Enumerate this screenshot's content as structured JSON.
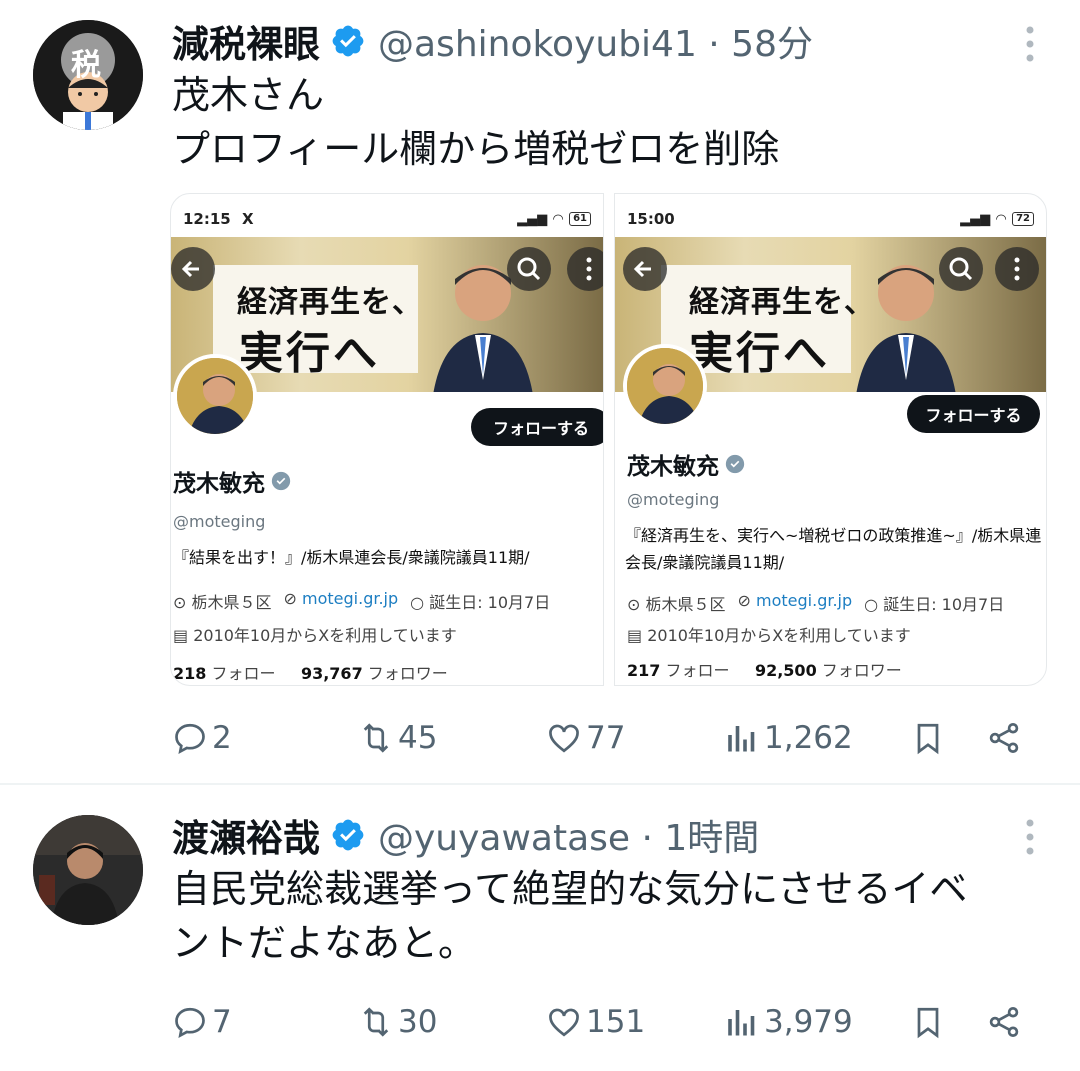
{
  "colors": {
    "verified": "#1d9bf0",
    "text": "#0f1419",
    "secondary": "#536471",
    "link": "#1d7ec2"
  },
  "tweets": [
    {
      "name": "減税裸眼",
      "handle": "@ashinokoyubi41 · 58分",
      "text_line1": "茂木さん",
      "text_line2": "プロフィール欄から増税ゼロを削除",
      "avatar_badge": "税",
      "media": [
        {
          "status_time": "12:15",
          "status_x": "X",
          "battery": "61",
          "slogan1": "経済再生を、",
          "slogan2": "実行へ",
          "follow": "フォローする",
          "name": "茂木敏充",
          "handle": "@moteging",
          "bio": "『結果を出す！』/栃木県連会長/衆議院議員11期/",
          "location": "栃木県５区",
          "website": "motegi.gr.jp",
          "birthday": "誕生日: 10月7日",
          "joined": "2010年10月からXを利用しています",
          "following_count": "218",
          "following_label": "フォロー",
          "followers_count": "93,767",
          "followers_label": "フォロワー"
        },
        {
          "status_time": "15:00",
          "battery": "72",
          "slogan1": "経済再生を、",
          "slogan2": "実行へ",
          "follow": "フォローする",
          "name": "茂木敏充",
          "handle": "@moteging",
          "bio": "『経済再生を、実行へ~増税ゼロの政策推進~』/栃木県連会長/衆議院議員11期/",
          "location": "栃木県５区",
          "website": "motegi.gr.jp",
          "birthday": "誕生日: 10月7日",
          "joined": "2010年10月からXを利用しています",
          "following_count": "217",
          "following_label": "フォロー",
          "followers_count": "92,500",
          "followers_label": "フォロワー"
        }
      ],
      "replies": "2",
      "reposts": "45",
      "likes": "77",
      "views": "1,262"
    },
    {
      "name": "渡瀬裕哉",
      "handle": "@yuyawatase · 1時間",
      "text_line1": "自民党総裁選挙って絶望的な気分にさせるイベ",
      "text_line2": "ントだよなあと。",
      "replies": "7",
      "reposts": "30",
      "likes": "151",
      "views": "3,979"
    }
  ]
}
